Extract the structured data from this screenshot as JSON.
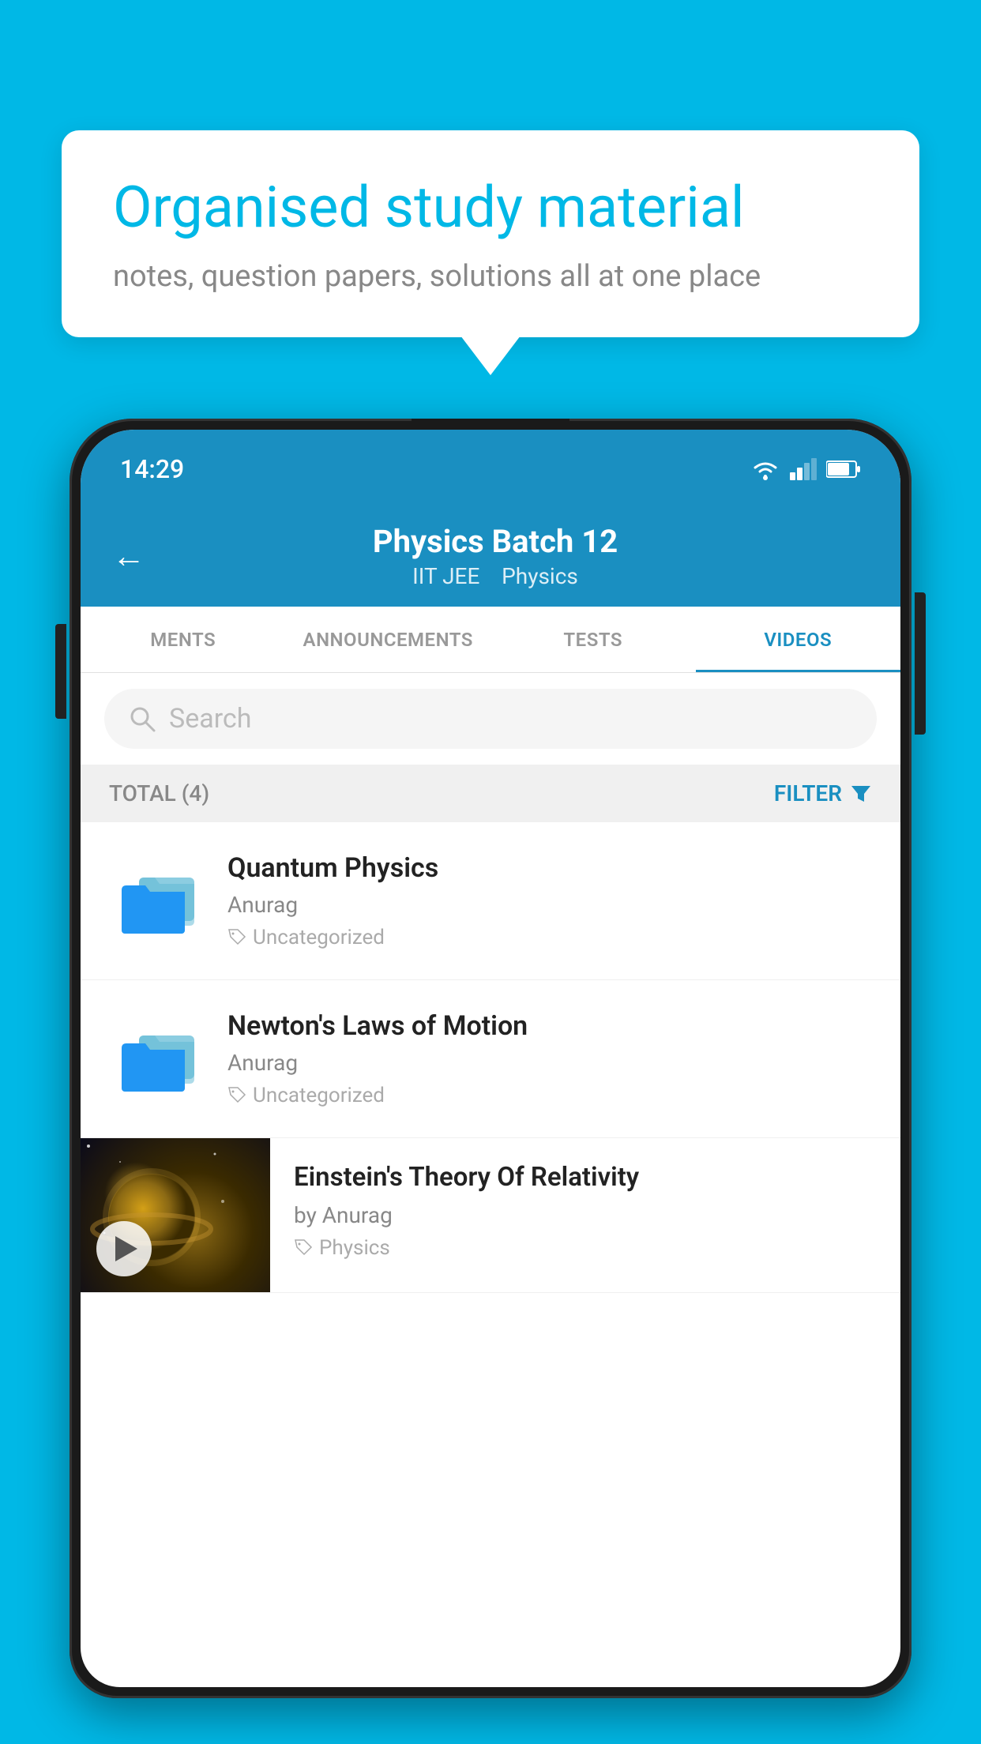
{
  "background_color": "#00b8e6",
  "speech_bubble": {
    "title": "Organised study material",
    "subtitle": "notes, question papers, solutions all at one place"
  },
  "status_bar": {
    "time": "14:29",
    "signal": "strong",
    "battery": "75"
  },
  "app_header": {
    "title": "Physics Batch 12",
    "subtitle_part1": "IIT JEE",
    "subtitle_part2": "Physics",
    "back_label": "←"
  },
  "tabs": [
    {
      "label": "MENTS",
      "active": false
    },
    {
      "label": "ANNOUNCEMENTS",
      "active": false
    },
    {
      "label": "TESTS",
      "active": false
    },
    {
      "label": "VIDEOS",
      "active": true
    }
  ],
  "search": {
    "placeholder": "Search"
  },
  "filter_bar": {
    "total_label": "TOTAL (4)",
    "filter_label": "FILTER"
  },
  "videos": [
    {
      "title": "Quantum Physics",
      "author": "Anurag",
      "tag": "Uncategorized",
      "type": "folder"
    },
    {
      "title": "Newton's Laws of Motion",
      "author": "Anurag",
      "tag": "Uncategorized",
      "type": "folder"
    },
    {
      "title": "Einstein's Theory Of Relativity",
      "author": "by Anurag",
      "tag": "Physics",
      "type": "video"
    }
  ]
}
